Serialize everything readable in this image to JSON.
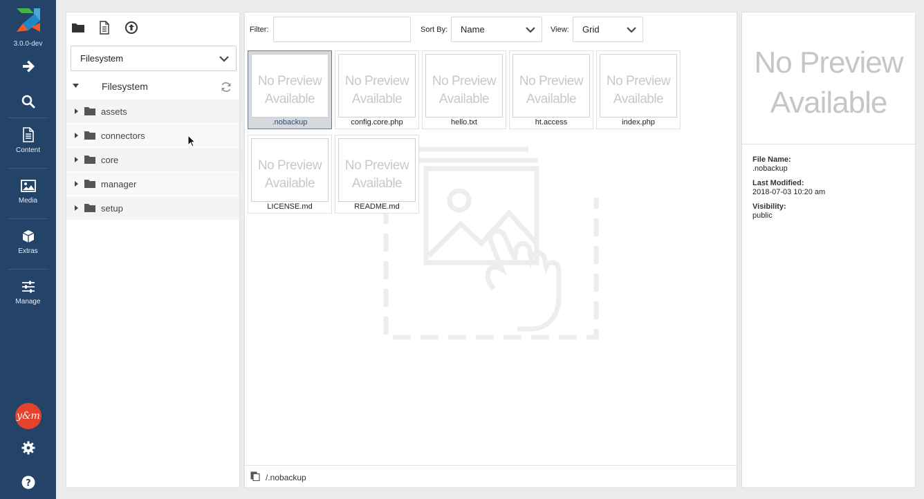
{
  "app": {
    "version": "3.0.0-dev",
    "avatar_text": "y&m"
  },
  "nav": {
    "content_label": "Content",
    "media_label": "Media",
    "extras_label": "Extras",
    "manage_label": "Manage"
  },
  "tree": {
    "source_selected": "Filesystem",
    "root_label": "Filesystem",
    "items": [
      {
        "label": "assets"
      },
      {
        "label": "connectors"
      },
      {
        "label": "core"
      },
      {
        "label": "manager"
      },
      {
        "label": "setup"
      }
    ]
  },
  "toolbar": {
    "filter_label": "Filter:",
    "filter_value": "",
    "sort_label": "Sort By:",
    "sort_value": "Name",
    "view_label": "View:",
    "view_value": "Grid"
  },
  "files": [
    {
      "name": ".nobackup",
      "preview": [
        "No Preview",
        "Available"
      ],
      "selected": true
    },
    {
      "name": "config.core.php",
      "preview": [
        "No Preview",
        "Available"
      ]
    },
    {
      "name": "hello.txt",
      "preview": [
        "No Preview",
        "Available"
      ]
    },
    {
      "name": "ht.access",
      "preview": [
        "No Preview",
        "Available"
      ]
    },
    {
      "name": "index.php",
      "preview": [
        "No Preview",
        "Available"
      ]
    },
    {
      "name": "LICENSE.md",
      "preview": [
        "No Preview",
        "Available"
      ]
    },
    {
      "name": "README.md",
      "preview": [
        "No Preview",
        "Available"
      ]
    }
  ],
  "status": {
    "path": "/.nobackup"
  },
  "info": {
    "preview_line1": "No Preview",
    "preview_line2": "Available",
    "file_name_label": "File Name:",
    "file_name": ".nobackup",
    "modified_label": "Last Modified:",
    "modified": "2018-07-03 10:20 am",
    "visibility_label": "Visibility:",
    "visibility": "public"
  },
  "colors": {
    "sidebar": "#234368",
    "selected_thumb": "#d5d9de",
    "avatar": "#e4422d"
  }
}
